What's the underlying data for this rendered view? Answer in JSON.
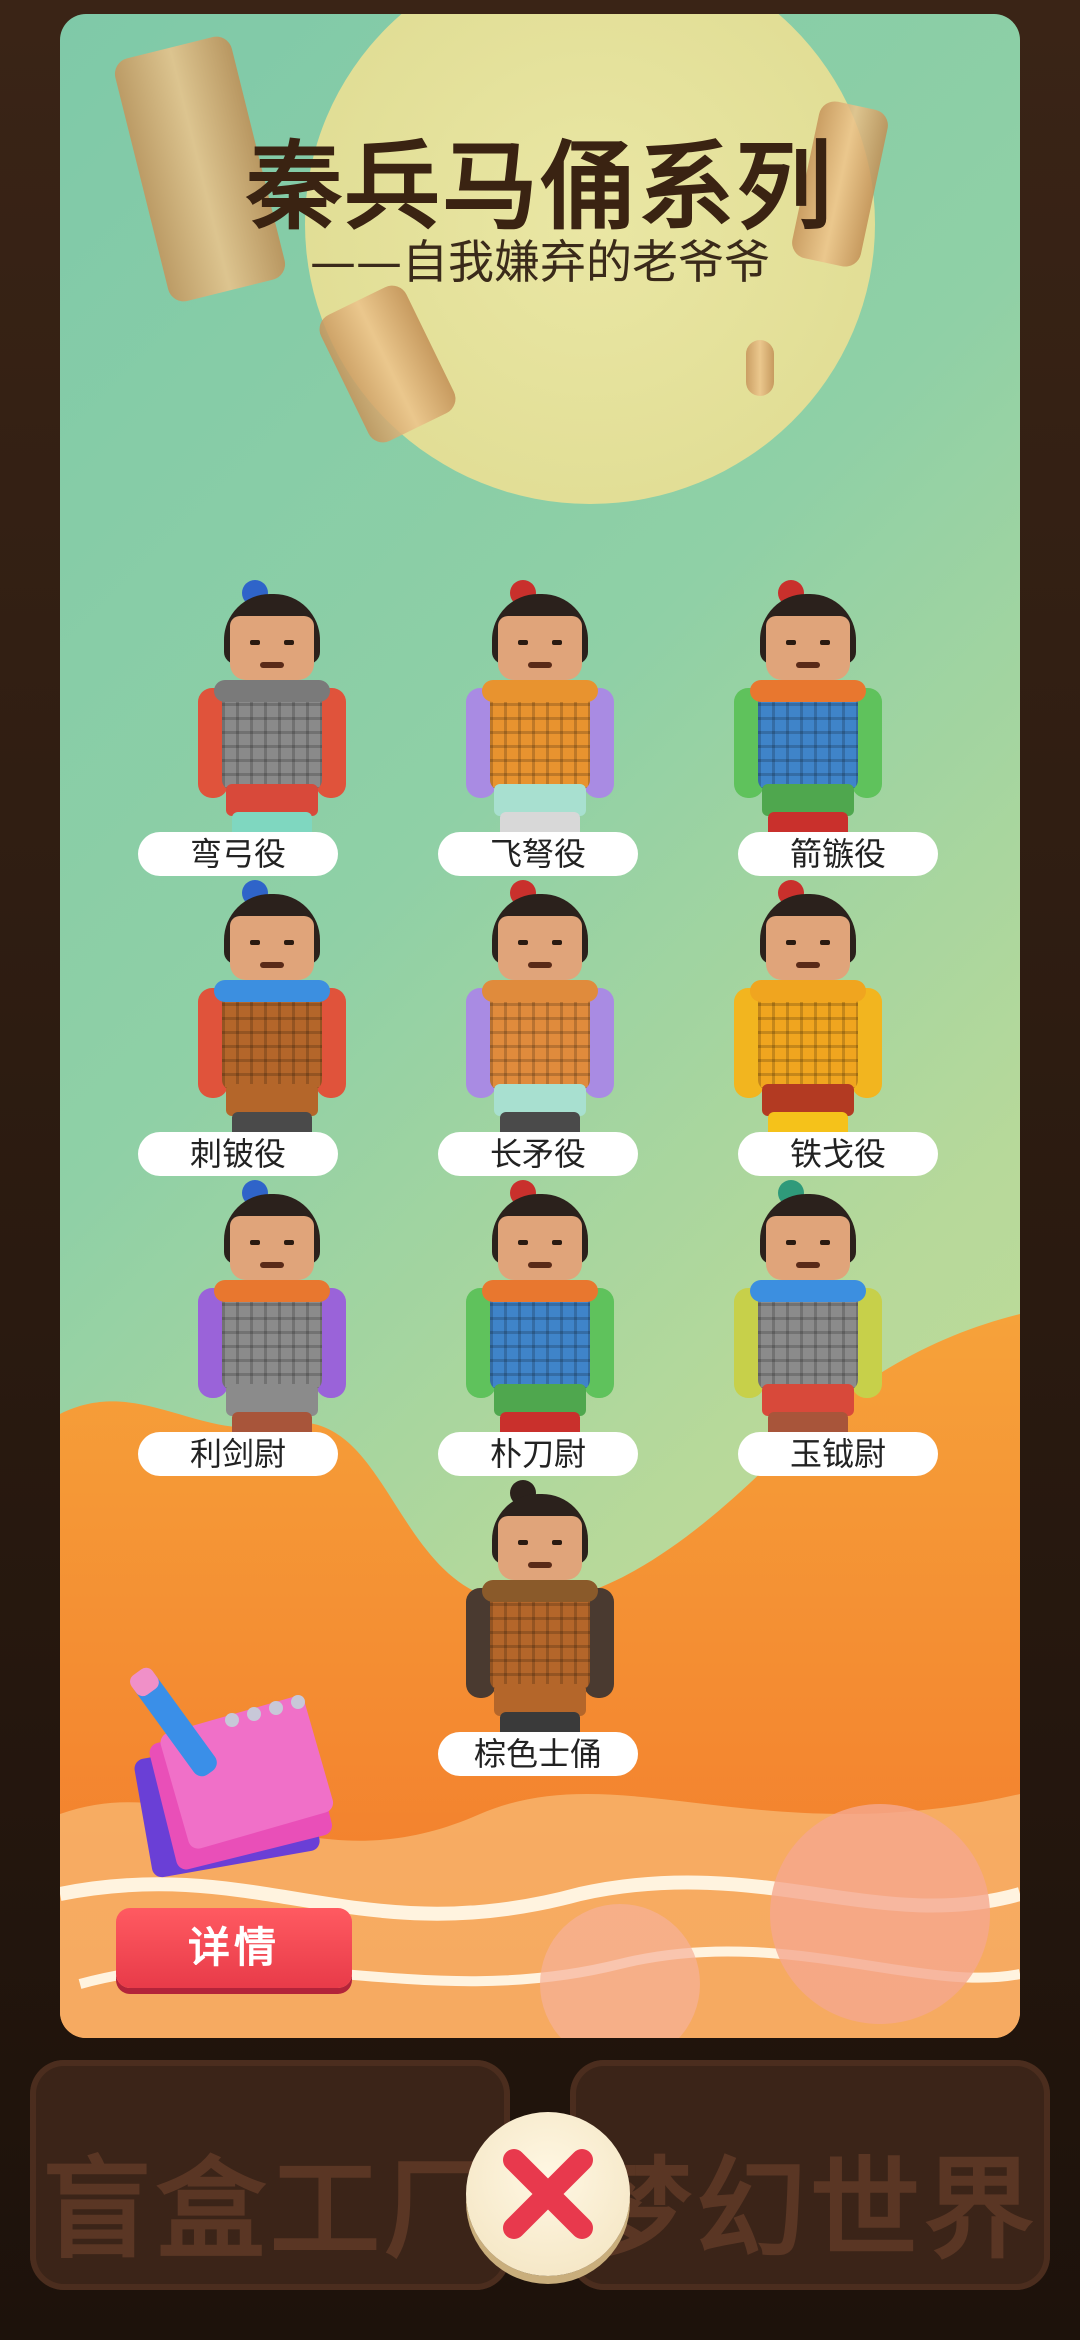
{
  "background": {
    "left_button_text": "盲盒工厂",
    "right_button_text": "梦幻世界"
  },
  "modal": {
    "title": "秦兵马俑系列",
    "subtitle": "——自我嫌弃的老爷爷",
    "figures": [
      {
        "label": "弯弓役",
        "colors": {
          "arm": "#e0533b",
          "body": "#8a8a8a",
          "collar": "#7a7a7a",
          "skirt": "#d8493a",
          "legs": "#7fd7c0",
          "knot": "#2f64c9"
        }
      },
      {
        "label": "飞弩役",
        "colors": {
          "arm": "#a98be3",
          "body": "#e8932f",
          "collar": "#e8932f",
          "skirt": "#a8e0d0",
          "legs": "#d8d8d8",
          "knot": "#c9302c"
        }
      },
      {
        "label": "箭镞役",
        "colors": {
          "arm": "#5fc25c",
          "body": "#3f84c9",
          "collar": "#e8772f",
          "skirt": "#4fa74e",
          "legs": "#c9302c",
          "knot": "#c9302c"
        }
      },
      {
        "label": "刺铍役",
        "colors": {
          "arm": "#e0533b",
          "body": "#b4662a",
          "collar": "#3c8fe0",
          "skirt": "#b4662a",
          "legs": "#4a4a4a",
          "knot": "#2f64c9"
        }
      },
      {
        "label": "长矛役",
        "colors": {
          "arm": "#a98be3",
          "body": "#e08b3c",
          "collar": "#e08b3c",
          "skirt": "#a8e0d0",
          "legs": "#4a4a4a",
          "knot": "#c9302c"
        }
      },
      {
        "label": "铁戈役",
        "colors": {
          "arm": "#f2b51f",
          "body": "#f0a51f",
          "collar": "#f0a51f",
          "skirt": "#b33a22",
          "legs": "#f5c21a",
          "knot": "#c9302c"
        }
      },
      {
        "label": "利剑尉",
        "colors": {
          "arm": "#9a63d9",
          "body": "#8b8b8b",
          "collar": "#e8772f",
          "skirt": "#8b8b8b",
          "legs": "#a8553a",
          "knot": "#2f64c9"
        }
      },
      {
        "label": "朴刀尉",
        "colors": {
          "arm": "#5fc25c",
          "body": "#3f84c9",
          "collar": "#e8772f",
          "skirt": "#4fa74e",
          "legs": "#c9302c",
          "knot": "#c9302c"
        }
      },
      {
        "label": "玉钺尉",
        "colors": {
          "arm": "#c7d04a",
          "body": "#8b8b8b",
          "collar": "#3c8fe0",
          "skirt": "#d8493a",
          "legs": "#a8553a",
          "knot": "#2f9a7a"
        }
      },
      {
        "label": "棕色士俑",
        "colors": {
          "arm": "#4a3a30",
          "body": "#b4662a",
          "collar": "#8a5a2a",
          "skirt": "#b4662a",
          "legs": "#3a3a3a",
          "knot": "#2b211c"
        }
      }
    ],
    "details_button": "详情"
  },
  "close_button_icon": "close-x-icon",
  "accent_colors": {
    "details": "#e83b49",
    "close_x": "#e8394d",
    "cloud": "#f28a2a"
  }
}
